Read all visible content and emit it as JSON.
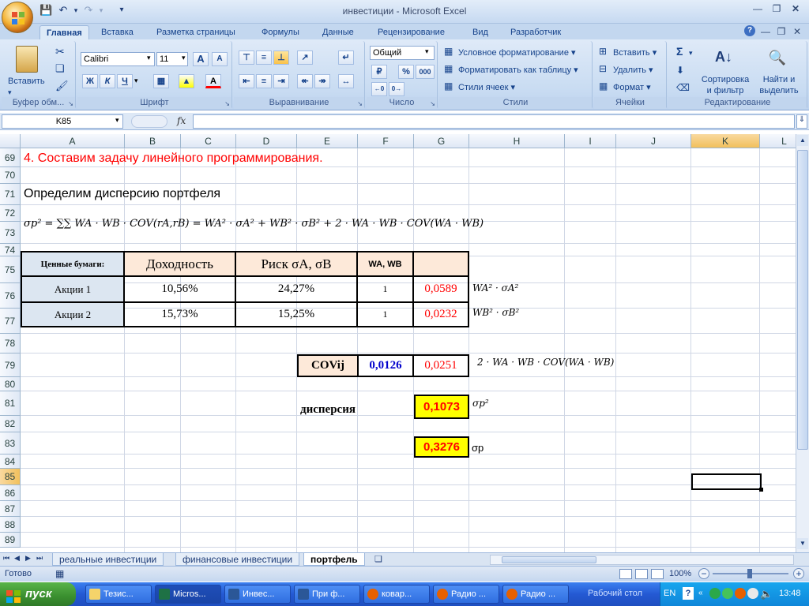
{
  "window": {
    "title": "инвестиции - Microsoft Excel"
  },
  "ribbon_tabs": [
    "Главная",
    "Вставка",
    "Разметка страницы",
    "Формулы",
    "Данные",
    "Рецензирование",
    "Вид",
    "Разработчик"
  ],
  "ribbon": {
    "clipboard": {
      "paste": "Вставить",
      "label": "Буфер обм..."
    },
    "font": {
      "name": "Calibri",
      "size": "11",
      "bold": "Ж",
      "italic": "К",
      "underline": "Ч",
      "grow": "A",
      "shrink": "A",
      "font_color": "A",
      "label": "Шрифт"
    },
    "alignment": {
      "label": "Выравнивание"
    },
    "number": {
      "format": "Общий",
      "percent": "%",
      "thousands": "000",
      "label": "Число"
    },
    "styles": {
      "conditional": "Условное форматирование",
      "as_table": "Форматировать как таблицу",
      "cell_styles": "Стили ячеек",
      "label": "Стили"
    },
    "cells": {
      "insert": "Вставить",
      "delete": "Удалить",
      "format": "Формат",
      "label": "Ячейки"
    },
    "editing": {
      "sum": "Σ",
      "sort1": "Сортировка",
      "sort2": "и фильтр",
      "find1": "Найти и",
      "find2": "выделить",
      "label": "Редактирование"
    }
  },
  "formula_bar": {
    "name_box": "K85",
    "fx": "fx",
    "value": ""
  },
  "columns": [
    "A",
    "B",
    "C",
    "D",
    "E",
    "F",
    "G",
    "H",
    "I",
    "J",
    "K",
    "L"
  ],
  "rows": [
    "69",
    "70",
    "71",
    "72",
    "73",
    "74",
    "75",
    "76",
    "77",
    "78",
    "79",
    "80",
    "81",
    "82",
    "83",
    "84",
    "85",
    "86",
    "87",
    "88",
    "89"
  ],
  "content": {
    "heading": "4. Составим задачу линейного программирования.",
    "subheading": "Определим дисперсию портфеля",
    "formula_main": "σp² = ∑∑ WA · WB · COV(rA,rB) = WA² · σA² + WB² · σB² + 2 · WA · WB · COV(WA · WB)",
    "table": {
      "headers": {
        "securities": "Ценные бумаги:",
        "return": "Доходность",
        "risk": "Риск σA, σB",
        "weights": "WA, WB"
      },
      "rows": [
        {
          "name": "Акции 1",
          "return": "10,56%",
          "risk": "24,27%",
          "weight": "1",
          "value": "0,0589",
          "note": "WA² · σA²"
        },
        {
          "name": "Акции 2",
          "return": "15,73%",
          "risk": "15,25%",
          "weight": "1",
          "value": "0,0232",
          "note": "WB² · σB²"
        }
      ]
    },
    "cov": {
      "label": "COVij",
      "value": "0,0126",
      "result": "0,0251",
      "note": "2 · WA · WB · COV(WA · WB)"
    },
    "variance": {
      "label": "дисперсия",
      "value": "0,1073",
      "note": "σp²"
    },
    "stdev": {
      "value": "0,3276",
      "note": "σp"
    }
  },
  "sheets": [
    "реальные инвестиции",
    "финансовые инвестиции",
    "портфель"
  ],
  "active_sheet": "портфель",
  "status": {
    "ready": "Готово",
    "zoom": "100%"
  },
  "taskbar": {
    "start": "пуск",
    "items": [
      "Тезис...",
      "Micros...",
      "Инвес...",
      "При ф...",
      "ковар...",
      "Радио ...",
      "Радио ..."
    ],
    "desktop": "Рабочий стол",
    "lang": "EN",
    "clock": "13:48"
  },
  "colors": {
    "header_fill": "#fde9d9",
    "name_fill": "#dce6f1",
    "highlight": "#ffff00",
    "red": "#ff0000",
    "blue": "#0000cc"
  }
}
